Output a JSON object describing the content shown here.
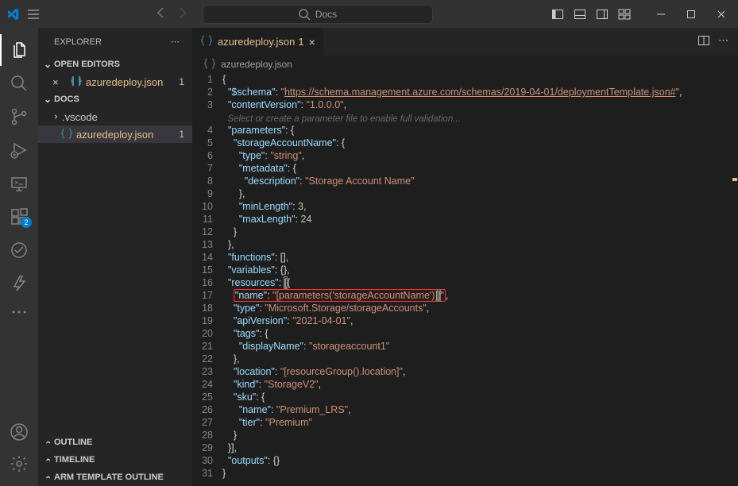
{
  "titlebar": {
    "search_placeholder": "Docs"
  },
  "sidebar": {
    "title": "EXPLORER",
    "sections": {
      "open_editors": {
        "label": "OPEN EDITORS"
      },
      "folder": {
        "label": "DOCS"
      },
      "outline": {
        "label": "OUTLINE"
      },
      "timeline": {
        "label": "TIMELINE"
      },
      "arm_outline": {
        "label": "ARM TEMPLATE OUTLINE"
      }
    },
    "open_editors": [
      {
        "name": "azuredeploy.json",
        "problems": "1"
      }
    ],
    "folder_items": {
      "vscode": ".vscode",
      "azuredeploy": {
        "name": "azuredeploy.json",
        "problems": "1"
      }
    }
  },
  "extensions_badge": "2",
  "tab": {
    "name": "azuredeploy.json",
    "problems": "1"
  },
  "breadcrumb": {
    "file": "azuredeploy.json"
  },
  "code": {
    "hint": "Select or create a parameter file to enable full validation...",
    "schema_url": "https://schema.management.azure.com/schemas/2019-04-01/deploymentTemplate.json#",
    "content_version": "1.0.0.0",
    "storage_type": "string",
    "description_val": "Storage Account Name",
    "min_length": "3",
    "max_length": "24",
    "name_expr_prefix": "[parameters(",
    "name_expr_param": "'storageAccountName'",
    "name_expr_suffix": ")]",
    "type_val": "Microsoft.Storage/storageAccounts",
    "api_version": "2021-04-01",
    "display_name": "storageaccount1",
    "location_val": "[resourceGroup().location]",
    "kind_val": "StorageV2",
    "sku_name": "Premium_LRS",
    "sku_tier": "Premium",
    "keys": {
      "schema": "\"$schema\"",
      "contentVersion": "\"contentVersion\"",
      "parameters": "\"parameters\"",
      "storageAccountName": "\"storageAccountName\"",
      "type": "\"type\"",
      "metadata": "\"metadata\"",
      "description": "\"description\"",
      "minLength": "\"minLength\"",
      "maxLength": "\"maxLength\"",
      "functions": "\"functions\"",
      "variables": "\"variables\"",
      "resources": "\"resources\"",
      "name": "\"name\"",
      "apiVersion": "\"apiVersion\"",
      "tags": "\"tags\"",
      "displayName": "\"displayName\"",
      "location": "\"location\"",
      "kind": "\"kind\"",
      "sku": "\"sku\"",
      "tier": "\"tier\"",
      "outputs": "\"outputs\""
    }
  },
  "line_numbers": [
    "1",
    "2",
    "3",
    "4",
    "5",
    "6",
    "7",
    "8",
    "9",
    "10",
    "11",
    "12",
    "13",
    "14",
    "15",
    "16",
    "17",
    "18",
    "19",
    "20",
    "21",
    "22",
    "23",
    "24",
    "25",
    "26",
    "27",
    "28",
    "29",
    "30",
    "31"
  ]
}
